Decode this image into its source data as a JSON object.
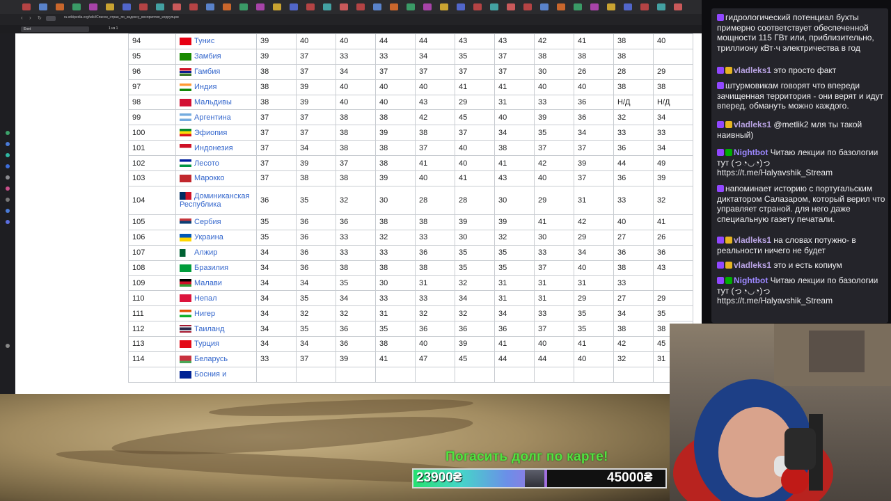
{
  "browser": {
    "url": "ru.wikipedia.org/wiki/Список_стран_по_индексу_восприятия_коррупции",
    "find_text": "Enet",
    "find_count": "1 из 1"
  },
  "table": {
    "rows": [
      {
        "rank": "94",
        "country": "Тунис",
        "flag": "tn",
        "values": [
          "39",
          "40",
          "40",
          "44",
          "44",
          "43",
          "43",
          "42",
          "41",
          "38",
          "40"
        ]
      },
      {
        "rank": "95",
        "country": "Замбия",
        "flag": "zm",
        "values": [
          "39",
          "37",
          "33",
          "33",
          "34",
          "35",
          "37",
          "38",
          "38",
          "38"
        ]
      },
      {
        "rank": "96",
        "country": "Гамбия",
        "flag": "gm",
        "values": [
          "38",
          "37",
          "34",
          "37",
          "37",
          "37",
          "37",
          "30",
          "26",
          "28",
          "29"
        ]
      },
      {
        "rank": "97",
        "country": "Индия",
        "flag": "in",
        "values": [
          "38",
          "39",
          "40",
          "40",
          "40",
          "41",
          "41",
          "40",
          "40",
          "38",
          "38"
        ]
      },
      {
        "rank": "98",
        "country": "Мальдивы",
        "flag": "mv",
        "values": [
          "38",
          "39",
          "40",
          "40",
          "43",
          "29",
          "31",
          "33",
          "36",
          "Н/Д",
          "Н/Д"
        ]
      },
      {
        "rank": "99",
        "country": "Аргентина",
        "flag": "ar",
        "values": [
          "37",
          "37",
          "38",
          "38",
          "42",
          "45",
          "40",
          "39",
          "36",
          "32",
          "34"
        ]
      },
      {
        "rank": "100",
        "country": "Эфиопия",
        "flag": "et",
        "values": [
          "37",
          "37",
          "38",
          "39",
          "38",
          "37",
          "34",
          "35",
          "34",
          "33",
          "33"
        ]
      },
      {
        "rank": "101",
        "country": "Индонезия",
        "flag": "id",
        "values": [
          "37",
          "34",
          "38",
          "38",
          "37",
          "40",
          "38",
          "37",
          "37",
          "36",
          "34"
        ]
      },
      {
        "rank": "102",
        "country": "Лесото",
        "flag": "ls",
        "values": [
          "37",
          "39",
          "37",
          "38",
          "41",
          "40",
          "41",
          "42",
          "39",
          "44",
          "49"
        ]
      },
      {
        "rank": "103",
        "country": "Марокко",
        "flag": "ma",
        "values": [
          "37",
          "38",
          "38",
          "39",
          "40",
          "41",
          "43",
          "40",
          "37",
          "36",
          "39"
        ]
      },
      {
        "rank": "104",
        "country": "Доминиканская Республика",
        "flag": "do",
        "values": [
          "36",
          "35",
          "32",
          "30",
          "28",
          "28",
          "30",
          "29",
          "31",
          "33",
          "32"
        ]
      },
      {
        "rank": "105",
        "country": "Сербия",
        "flag": "rs",
        "values": [
          "35",
          "36",
          "36",
          "38",
          "38",
          "39",
          "39",
          "41",
          "42",
          "40",
          "41"
        ]
      },
      {
        "rank": "106",
        "country": "Украина",
        "flag": "ua",
        "values": [
          "35",
          "36",
          "33",
          "32",
          "33",
          "30",
          "32",
          "30",
          "29",
          "27",
          "26"
        ]
      },
      {
        "rank": "107",
        "country": "Алжир",
        "flag": "dz",
        "values": [
          "34",
          "36",
          "33",
          "33",
          "36",
          "35",
          "35",
          "33",
          "34",
          "36",
          "36"
        ]
      },
      {
        "rank": "108",
        "country": "Бразилия",
        "flag": "br",
        "values": [
          "34",
          "36",
          "38",
          "38",
          "38",
          "35",
          "35",
          "37",
          "40",
          "38",
          "43"
        ]
      },
      {
        "rank": "109",
        "country": "Малави",
        "flag": "mw",
        "values": [
          "34",
          "34",
          "35",
          "30",
          "31",
          "32",
          "31",
          "31",
          "31",
          "33"
        ]
      },
      {
        "rank": "110",
        "country": "Непал",
        "flag": "np",
        "values": [
          "34",
          "35",
          "34",
          "33",
          "33",
          "34",
          "31",
          "31",
          "29",
          "27",
          "29"
        ]
      },
      {
        "rank": "111",
        "country": "Нигер",
        "flag": "ne",
        "values": [
          "34",
          "32",
          "32",
          "31",
          "32",
          "32",
          "34",
          "33",
          "35",
          "34",
          "35"
        ]
      },
      {
        "rank": "112",
        "country": "Таиланд",
        "flag": "th",
        "values": [
          "34",
          "35",
          "36",
          "35",
          "36",
          "36",
          "36",
          "37",
          "35",
          "38",
          "38"
        ]
      },
      {
        "rank": "113",
        "country": "Турция",
        "flag": "tr",
        "values": [
          "34",
          "34",
          "36",
          "38",
          "40",
          "39",
          "41",
          "40",
          "41",
          "42",
          "45"
        ]
      },
      {
        "rank": "114",
        "country": "Беларусь",
        "flag": "by",
        "values": [
          "33",
          "37",
          "39",
          "41",
          "47",
          "45",
          "44",
          "44",
          "40",
          "32",
          "31"
        ]
      },
      {
        "rank": "",
        "country": "Босния и",
        "flag": "ba",
        "values": [
          "",
          "",
          "",
          "",
          "",
          "",
          "",
          "",
          "",
          "",
          ""
        ]
      }
    ]
  },
  "chat": [
    {
      "user": "",
      "text": "гидрологический потенциал бухты примерно соответствует обеспеченной мощности 115 ГВт или, приблизительно, триллиону кВт·ч электричества в год",
      "user_color": "#7d5cff"
    },
    {
      "user": "vladleks1",
      "text": "это просто факт",
      "user_color": "#b9a3e3"
    },
    {
      "user": "",
      "text": "штурмовикам говорят что впереди зачищенная территория - они верят и идут вперед. обмануть можно каждого.",
      "user_color": "#7d5cff"
    },
    {
      "user": "vladleks1",
      "text": "@metlik2 мля ты такой наивный)",
      "user_color": "#b9a3e3"
    },
    {
      "user": "Nightbot",
      "text": "Читаю лекции по базологии тут (っ◔◡◔)っ https://t.me/Halyavshik_Stream",
      "user_color": "#9c88ff"
    },
    {
      "user": "",
      "text": "напоминает историю с португальским диктатором Салазаром, который верил что управляет страной. для него даже специальную газету печатали.",
      "user_color": "#7d5cff"
    },
    {
      "user": "vladleks1",
      "text": "на словах потужно- в реальности ничего не будет",
      "user_color": "#b9a3e3"
    },
    {
      "user": "vladleks1",
      "text": "это и есть копиум",
      "user_color": "#b9a3e3"
    },
    {
      "user": "Nightbot",
      "text": "Читаю лекции по базологии тут (っ◔◡◔)っ https://t.me/Halyavshik_Stream",
      "user_color": "#9c88ff"
    }
  ],
  "donation_goal": {
    "title": "Погасить долг по карте!",
    "current": "23900₴",
    "target": "45000₴",
    "progress": 0.531
  }
}
